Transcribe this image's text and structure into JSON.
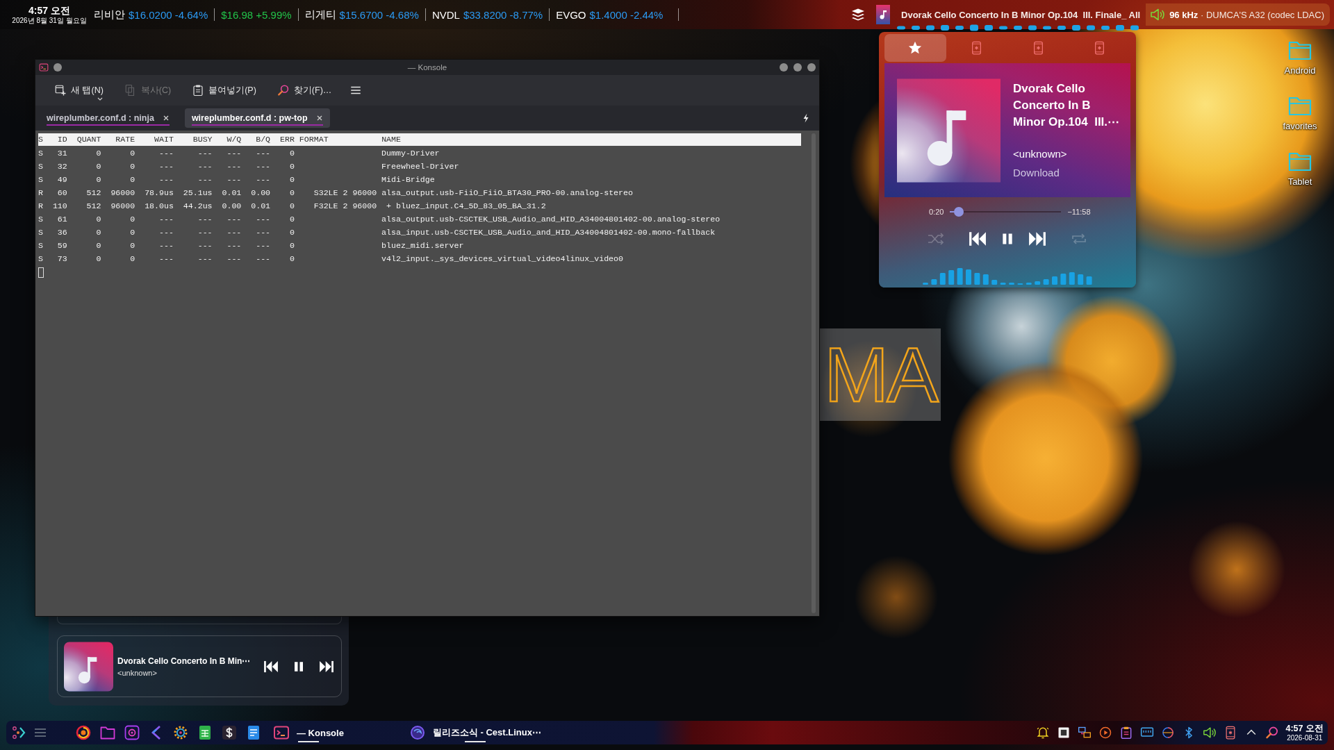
{
  "top_bar": {
    "time": "4:57 오전",
    "date": "2026년 8월 31일 월요일",
    "tickers": [
      {
        "name": "리비안",
        "quote": "$16.0200 -4.64%",
        "color": "#2b9af3"
      },
      {
        "quote": "$16.98 +5.99%",
        "color": "#22c34a"
      },
      {
        "name": "리게티",
        "quote": "$15.6700 -4.68%",
        "color": "#2b9af3"
      },
      {
        "name": "NVDL",
        "quote": "$33.8200 -8.77%",
        "color": "#2b9af3"
      },
      {
        "name": "EVGO",
        "quote": "$1.4000 -2.44%",
        "color": "#2b9af3"
      }
    ],
    "now_playing": "Dvorak Cello Concerto In B Minor Op.104  III. Finale_ All",
    "audio_output": "**96 kHz** · DUMCA'S A32 (codec LDAC)"
  },
  "konsole": {
    "title": "— Konsole",
    "toolbar": [
      {
        "label": "새 탭(N)",
        "disabled": false
      },
      {
        "label": "복사(C)",
        "disabled": true
      },
      {
        "label": "붙여넣기(P)",
        "disabled": false
      },
      {
        "label": "찾기(F)…",
        "disabled": false
      }
    ],
    "tabs": [
      {
        "label": "wireplumber.conf.d : ninja",
        "selected": false
      },
      {
        "label": "wireplumber.conf.d : pw-top",
        "selected": true
      }
    ],
    "terminal": {
      "columns": [
        "S",
        "ID",
        "QUANT",
        "RATE",
        "WAIT",
        "BUSY",
        "W/Q",
        "B/Q",
        "ERR",
        "FORMAT",
        "NAME"
      ],
      "rows": [
        {
          "s": "S",
          "id": "31",
          "quant": "0",
          "rate": "0",
          "wait": "---",
          "busy": "---",
          "w_q": "---",
          "b_q": "---",
          "err": "0",
          "name": "Dummy-Driver"
        },
        {
          "s": "S",
          "id": "32",
          "quant": "0",
          "rate": "0",
          "wait": "---",
          "busy": "---",
          "w_q": "---",
          "b_q": "---",
          "err": "0",
          "name": "Freewheel-Driver"
        },
        {
          "s": "S",
          "id": "49",
          "quant": "0",
          "rate": "0",
          "wait": "---",
          "busy": "---",
          "w_q": "---",
          "b_q": "---",
          "err": "0",
          "name": "Midi-Bridge"
        },
        {
          "s": "R",
          "id": "60",
          "quant": "512",
          "rate": "96000",
          "wait": "78.9us",
          "busy": "25.1us",
          "w_q": "0.01",
          "b_q": "0.00",
          "err": "0",
          "format": "S32LE 2 96000",
          "name": "alsa_output.usb-FiiO_FiiO_BTA30_PRO-00.analog-stereo",
          "children": [
            {
              "s": "R",
              "id": "110",
              "quant": "512",
              "rate": "96000",
              "wait": "18.0us",
              "busy": "44.2us",
              "w_q": "0.00",
              "b_q": "0.01",
              "err": "0",
              "format": "F32LE 2 96000",
              "name": "+ bluez_input.C4_5D_83_05_BA_31.2"
            }
          ]
        },
        {
          "s": "S",
          "id": "61",
          "quant": "0",
          "rate": "0",
          "wait": "---",
          "busy": "---",
          "w_q": "---",
          "b_q": "---",
          "err": "0",
          "name": "alsa_output.usb-CSCTEK_USB_Audio_and_HID_A34004801402-00.analog-stereo"
        },
        {
          "s": "S",
          "id": "36",
          "quant": "0",
          "rate": "0",
          "wait": "---",
          "busy": "---",
          "w_q": "---",
          "b_q": "---",
          "err": "0",
          "name": "alsa_input.usb-CSCTEK_USB_Audio_and_HID_A34004801402-00.mono-fallback"
        },
        {
          "s": "S",
          "id": "59",
          "quant": "0",
          "rate": "0",
          "wait": "---",
          "busy": "---",
          "w_q": "---",
          "b_q": "---",
          "err": "0",
          "name": "bluez_midi.server"
        },
        {
          "s": "S",
          "id": "73",
          "quant": "0",
          "rate": "0",
          "wait": "---",
          "busy": "---",
          "w_q": "---",
          "b_q": "---",
          "err": "0",
          "name": "v4l2_input._sys_devices_virtual_video4linux_video0"
        }
      ]
    }
  },
  "music_popup": {
    "tabs": [
      {
        "selected": true
      },
      {
        "selected": false
      },
      {
        "selected": false
      },
      {
        "selected": false
      }
    ],
    "title": "Dvorak Cello Concerto In B Minor Op.104  III.⋯",
    "artist": "<unknown>",
    "album": "Download",
    "elapsed": "0:20",
    "remaining": "−11:58",
    "level": 0.04,
    "shuffle": false,
    "repeat": false,
    "playing": true
  },
  "desktop_icons": [
    {
      "label": "Android"
    },
    {
      "label": "favorites"
    },
    {
      "label": "Tablet"
    }
  ],
  "logo_widget": {
    "text": "MA"
  },
  "mini_player": {
    "title": "Dvorak Cello Concerto In B Min⋯",
    "artist": "<unknown>",
    "playing": true
  },
  "taskbar": {
    "tasks": [
      {
        "label": "— Konsole"
      },
      {
        "label": "릴리즈소식 - Cest.Linux⋯"
      }
    ],
    "time": "4:57 오전",
    "date": "2026-08-31"
  }
}
